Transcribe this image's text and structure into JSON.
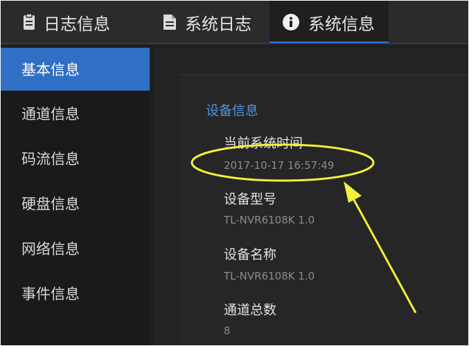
{
  "tabs": {
    "log_info": "日志信息",
    "system_log": "系统日志",
    "system_info": "系统信息"
  },
  "sidebar": {
    "items": [
      {
        "label": "基本信息",
        "active": true
      },
      {
        "label": "通道信息",
        "active": false
      },
      {
        "label": "码流信息",
        "active": false
      },
      {
        "label": "硬盘信息",
        "active": false
      },
      {
        "label": "网络信息",
        "active": false
      },
      {
        "label": "事件信息",
        "active": false
      }
    ]
  },
  "main": {
    "section_title": "设备信息",
    "fields": [
      {
        "label": "当前系统时间",
        "value": "2017-10-17 16:57:49"
      },
      {
        "label": "设备型号",
        "value": "TL-NVR6108K 1.0"
      },
      {
        "label": "设备名称",
        "value": "TL-NVR6108K 1.0"
      },
      {
        "label": "通道总数",
        "value": "8"
      }
    ]
  },
  "colors": {
    "accent": "#2f6fc4",
    "section_title": "#4b97e6",
    "annotation": "#f2f23a"
  },
  "icons": [
    "document-icon",
    "document-lines-icon",
    "info-circle-icon"
  ]
}
